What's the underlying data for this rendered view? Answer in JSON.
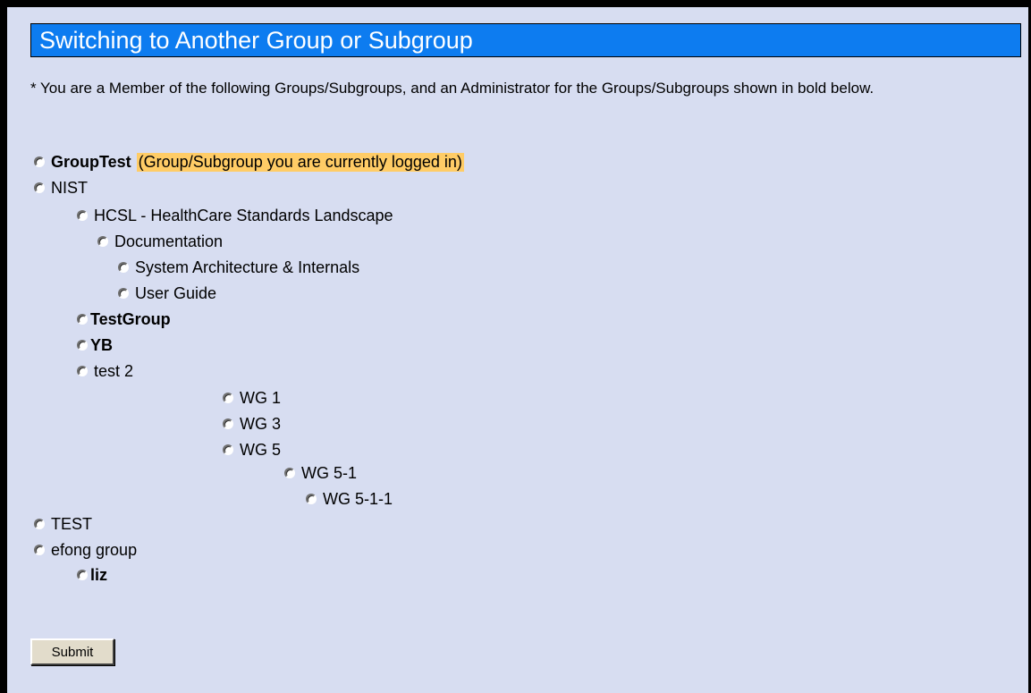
{
  "title": "Switching to Another Group or Subgroup",
  "note": "* You are a Member of the following Groups/Subgroups, and an Administrator for the Groups/Subgroups shown in bold below.",
  "groups": [
    {
      "label": "GroupTest",
      "bold": true,
      "current_label": "(Group/Subgroup you are currently logged in)"
    },
    {
      "label": "NIST",
      "bold": false
    },
    {
      "label": "HCSL - HealthCare Standards Landscape",
      "bold": false
    },
    {
      "label": "Documentation",
      "bold": false
    },
    {
      "label": "System Architecture & Internals",
      "bold": false
    },
    {
      "label": "User Guide",
      "bold": false
    },
    {
      "label": "TestGroup",
      "bold": true
    },
    {
      "label": "YB",
      "bold": true
    },
    {
      "label": "test 2",
      "bold": false
    },
    {
      "label": "WG 1",
      "bold": false
    },
    {
      "label": "WG 3",
      "bold": false
    },
    {
      "label": "WG 5",
      "bold": false
    },
    {
      "label": "WG 5-1",
      "bold": false
    },
    {
      "label": "WG 5-1-1",
      "bold": false
    },
    {
      "label": "TEST",
      "bold": false
    },
    {
      "label": "efong group",
      "bold": false
    },
    {
      "label": "liz",
      "bold": true
    }
  ],
  "submit_label": "Submit",
  "colors": {
    "background": "#d7ddf1",
    "title_bar": "#0d7cf0",
    "current_highlight": "#ffcc66"
  }
}
